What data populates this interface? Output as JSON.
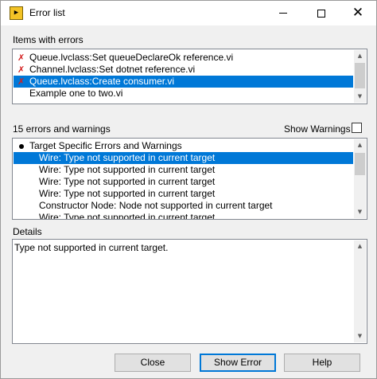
{
  "window": {
    "title": "Error list",
    "icon": "labview-app-icon",
    "close_glyph": "✕"
  },
  "items_with_errors": {
    "label": "Items with errors",
    "items": [
      {
        "text": "Queue.lvclass:Set queueDeclareOk reference.vi",
        "error": true,
        "selected": false
      },
      {
        "text": "Channel.lvclass:Set dotnet reference.vi",
        "error": true,
        "selected": false
      },
      {
        "text": "Queue.lvclass:Create consumer.vi",
        "error": true,
        "selected": true
      },
      {
        "text": "Example one to two.vi",
        "error": false,
        "selected": false
      }
    ]
  },
  "errors": {
    "count_label": "15 errors and warnings",
    "show_warnings_label": "Show Warnings",
    "show_warnings_checked": false,
    "group": "Target Specific Errors and Warnings",
    "items": [
      {
        "text": "Wire: Type not supported in current target",
        "selected": true
      },
      {
        "text": "Wire: Type not supported in current target",
        "selected": false
      },
      {
        "text": "Wire: Type not supported in current target",
        "selected": false
      },
      {
        "text": "Wire: Type not supported in current target",
        "selected": false
      },
      {
        "text": "Constructor Node: Node not supported in current target",
        "selected": false
      },
      {
        "text": "Wire: Type not supported in current target",
        "selected": false
      }
    ]
  },
  "details": {
    "label": "Details",
    "text": "Type not supported in current target."
  },
  "buttons": {
    "close": "Close",
    "show_error": "Show Error",
    "help": "Help"
  },
  "colors": {
    "selection": "#0078d7",
    "error_mark": "#d42020"
  }
}
